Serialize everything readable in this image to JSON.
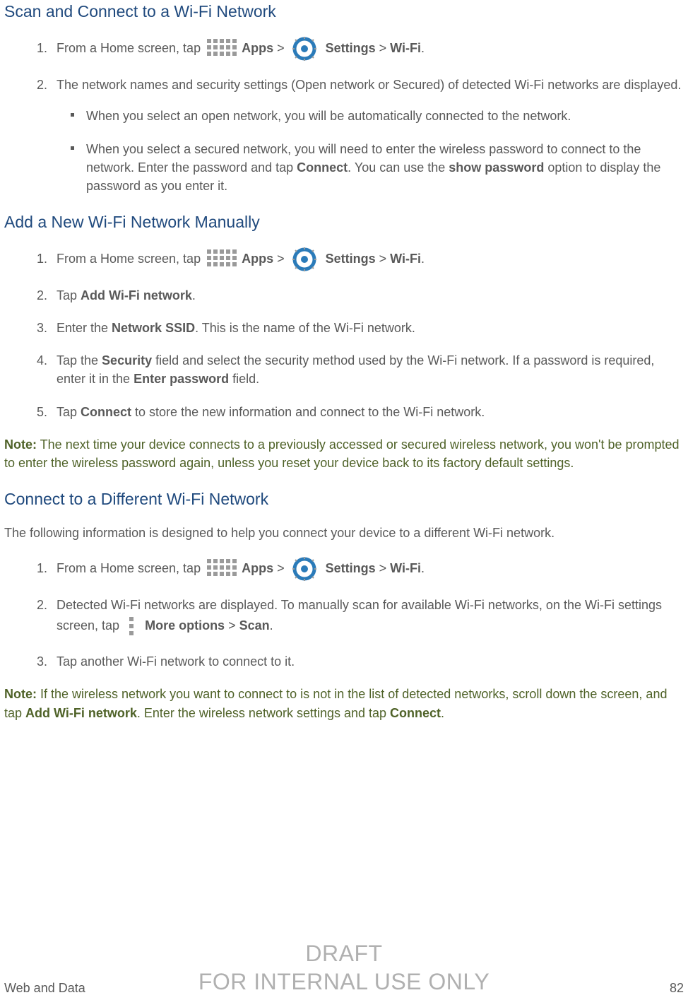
{
  "headings": {
    "scan": "Scan and Connect to a Wi-Fi Network",
    "add": "Add a New Wi-Fi Network Manually",
    "connect": "Connect to a Different Wi-Fi Network"
  },
  "common": {
    "from_home_tap": "From a Home screen, tap ",
    "apps_label": "Apps",
    "sep": " > ",
    "settings_label": "Settings",
    "wifi_label": "Wi-Fi",
    "period": "."
  },
  "scan_section": {
    "step2": "The network names and security settings (Open network or Secured) of detected Wi-Fi networks are displayed.",
    "bullet1": "When you select an open network, you will be automatically connected to the network.",
    "bullet2_a": "When you select a secured network, you will need to enter the wireless password to connect to the network. Enter the password and tap ",
    "bullet2_connect": "Connect",
    "bullet2_b": ". You can use the ",
    "bullet2_showpw": "show password",
    "bullet2_c": " option to display the password as you enter it."
  },
  "add_section": {
    "step2_a": "Tap ",
    "step2_bold": "Add Wi-Fi network",
    "step2_b": ".",
    "step3_a": "Enter the ",
    "step3_bold": "Network SSID",
    "step3_b": ". This is the name of the Wi-Fi network.",
    "step4_a": "Tap the ",
    "step4_bold1": "Security",
    "step4_b": " field and select the security method used by the Wi-Fi network. If a password is required, enter it in the ",
    "step4_bold2": "Enter password",
    "step4_c": " field.",
    "step5_a": "Tap ",
    "step5_bold": "Connect",
    "step5_b": " to store the new information and connect to the Wi-Fi network."
  },
  "note1": {
    "label": "Note:",
    "text": " The next time your device connects to a previously accessed or secured wireless network, you won't be prompted to enter the wireless password again, unless you reset your device back to its factory default settings."
  },
  "connect_section": {
    "intro": "The following information is designed to help you connect your device to a different Wi-Fi network.",
    "step2_a": "Detected Wi-Fi networks are displayed. To manually scan for available Wi-Fi networks, on the Wi-Fi settings screen, tap ",
    "step2_more": "More options",
    "step2_b": " > ",
    "step2_scan": "Scan",
    "step2_c": ".",
    "step3": "Tap another Wi-Fi network to connect to it."
  },
  "note2": {
    "label": "Note:",
    "text_a": " If the wireless network you want to connect to is not in the list of detected networks, scroll down the screen, and tap ",
    "bold1": "Add Wi-Fi network",
    "text_b": ". Enter the wireless network settings and tap ",
    "bold2": "Connect",
    "text_c": "."
  },
  "footer": {
    "left": "Web and Data",
    "page": "82"
  },
  "watermark": {
    "line1": "DRAFT",
    "line2": "FOR INTERNAL USE ONLY"
  }
}
